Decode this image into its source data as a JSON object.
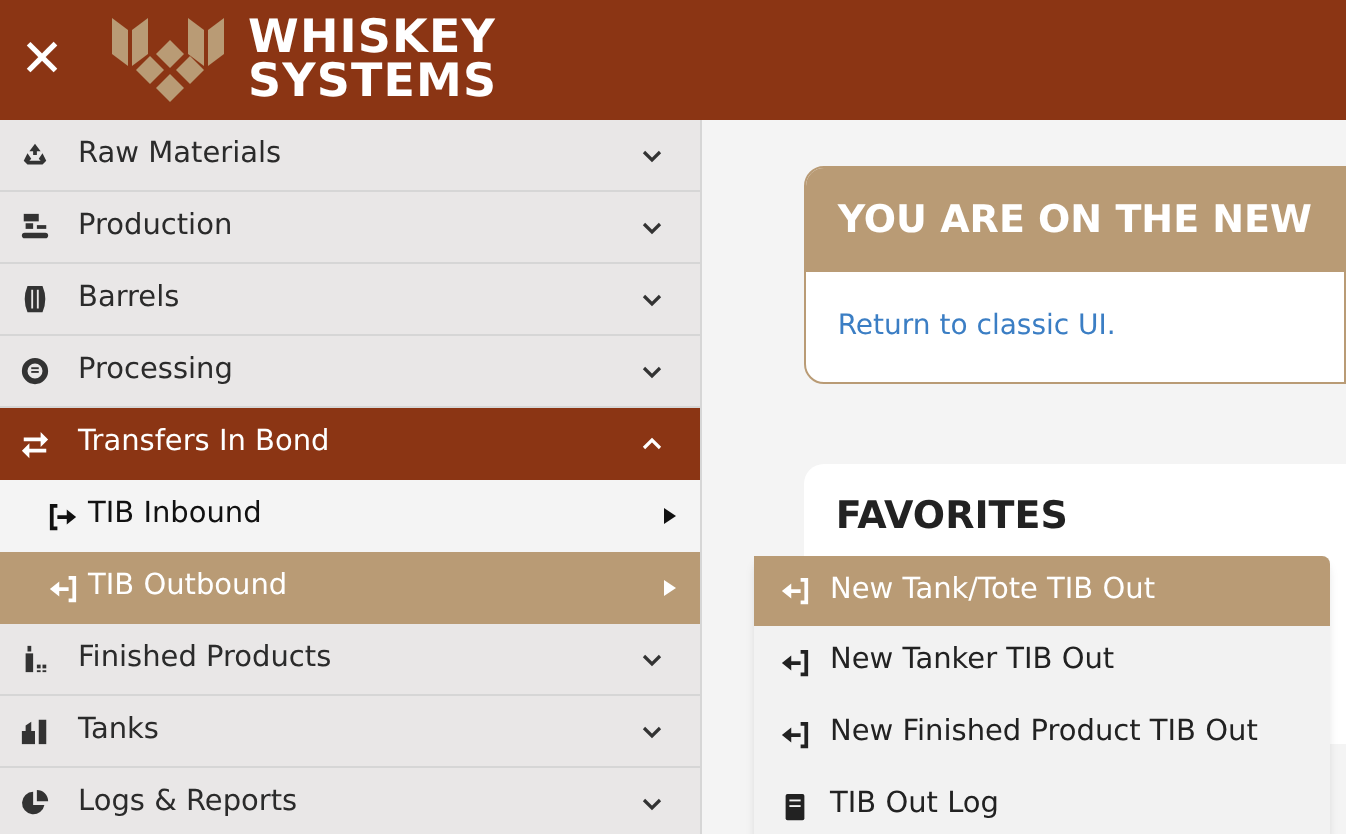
{
  "header": {
    "close": "✕",
    "brand_line_1": "WHISKEY",
    "brand_line_2": "SYSTEMS"
  },
  "sidebar": {
    "items": [
      {
        "label": "Raw Materials",
        "expanded": false
      },
      {
        "label": "Production",
        "expanded": false
      },
      {
        "label": "Barrels",
        "expanded": false
      },
      {
        "label": "Processing",
        "expanded": false
      },
      {
        "label": "Transfers In Bond",
        "expanded": true,
        "children": [
          {
            "label": "TIB Inbound",
            "selected": false
          },
          {
            "label": "TIB Outbound",
            "selected": true
          }
        ]
      },
      {
        "label": "Finished Products",
        "expanded": false
      },
      {
        "label": "Tanks",
        "expanded": false
      },
      {
        "label": "Logs & Reports",
        "expanded": false
      }
    ]
  },
  "banner": {
    "title": "YOU ARE ON THE NEW",
    "link": "Return to classic UI."
  },
  "favorites": {
    "title": "FAVORITES"
  },
  "flyout": {
    "items": [
      {
        "label": "New Tank/Tote TIB Out",
        "selected": true
      },
      {
        "label": "New Tanker TIB Out",
        "selected": false
      },
      {
        "label": "New Finished Product TIB Out",
        "selected": false
      },
      {
        "label": "TIB Out Log",
        "selected": false
      }
    ]
  }
}
